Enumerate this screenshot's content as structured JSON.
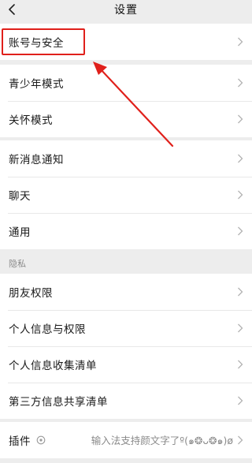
{
  "header": {
    "title": "设置",
    "back_icon": "chevron-left-icon"
  },
  "groups": {
    "account": {
      "items": [
        {
          "label": "账号与安全"
        }
      ]
    },
    "modes": {
      "items": [
        {
          "label": "青少年模式"
        },
        {
          "label": "关怀模式"
        }
      ]
    },
    "general": {
      "items": [
        {
          "label": "新消息通知"
        },
        {
          "label": "聊天"
        },
        {
          "label": "通用"
        }
      ]
    },
    "privacy": {
      "section_label": "隐私",
      "items": [
        {
          "label": "朋友权限"
        },
        {
          "label": "个人信息与权限"
        },
        {
          "label": "个人信息收集清单"
        },
        {
          "label": "第三方信息共享清单"
        }
      ]
    },
    "plugins": {
      "items": [
        {
          "label": "插件",
          "value": "输入法支持颜文字了º(๑❂ᴗ❂๑)ø"
        }
      ]
    }
  },
  "annotation": {
    "color": "#e0201b"
  }
}
